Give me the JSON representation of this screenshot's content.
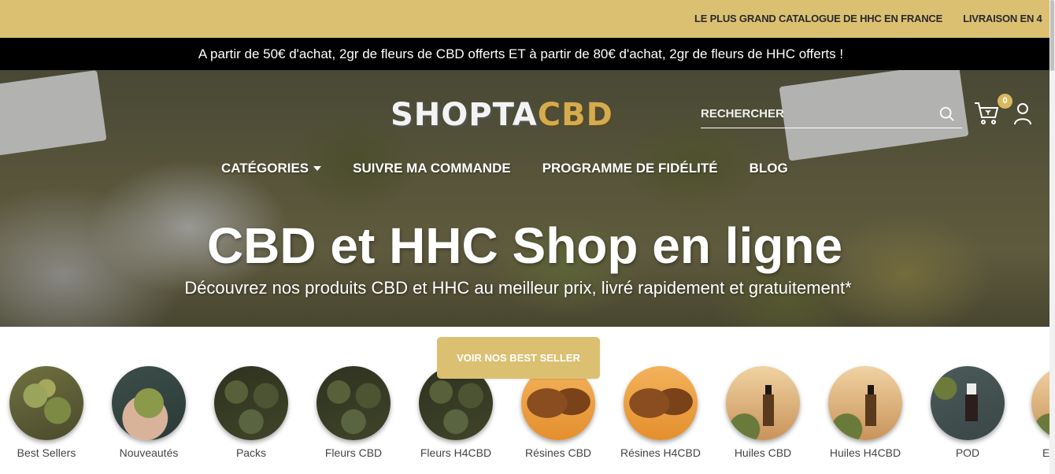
{
  "topbar": {
    "ticker": [
      "LE PLUS GRAND CATALOGUE DE HHC EN FRANCE",
      "LIVRAISON EN 4"
    ]
  },
  "promo": {
    "text": "A partir de 50€ d'achat, 2gr de fleurs de CBD offerts ET à partir de 80€ d'achat, 2gr de fleurs de HHC offerts !"
  },
  "header": {
    "logo_part1": "SHOPTA",
    "logo_part2": "CBD",
    "search_placeholder": "RECHERCHER",
    "cart_count": "0",
    "nav": [
      {
        "label": "CATÉGORIES"
      },
      {
        "label": "SUIVRE MA COMMANDE"
      },
      {
        "label": "PROGRAMME DE FIDÉLITÉ"
      },
      {
        "label": "BLOG"
      }
    ]
  },
  "hero": {
    "title": "CBD et HHC Shop en ligne",
    "subtitle": "Découvrez nos produits CBD et HHC au meilleur prix, livré rapidement et gratuitement*"
  },
  "cta": {
    "label": "VOIR NOS BEST SELLER"
  },
  "categories": [
    {
      "label": "Best Sellers"
    },
    {
      "label": "Nouveautés"
    },
    {
      "label": "Packs"
    },
    {
      "label": "Fleurs CBD"
    },
    {
      "label": "Fleurs H4CBD"
    },
    {
      "label": "Résines CBD"
    },
    {
      "label": "Résines H4CBD"
    },
    {
      "label": "Huiles CBD"
    },
    {
      "label": "Huiles H4CBD"
    },
    {
      "label": "POD"
    },
    {
      "label": "E"
    }
  ],
  "colors": {
    "accent": "#dcc072",
    "promo_bg": "#000000",
    "logo_gold": "#d5ab4e"
  }
}
